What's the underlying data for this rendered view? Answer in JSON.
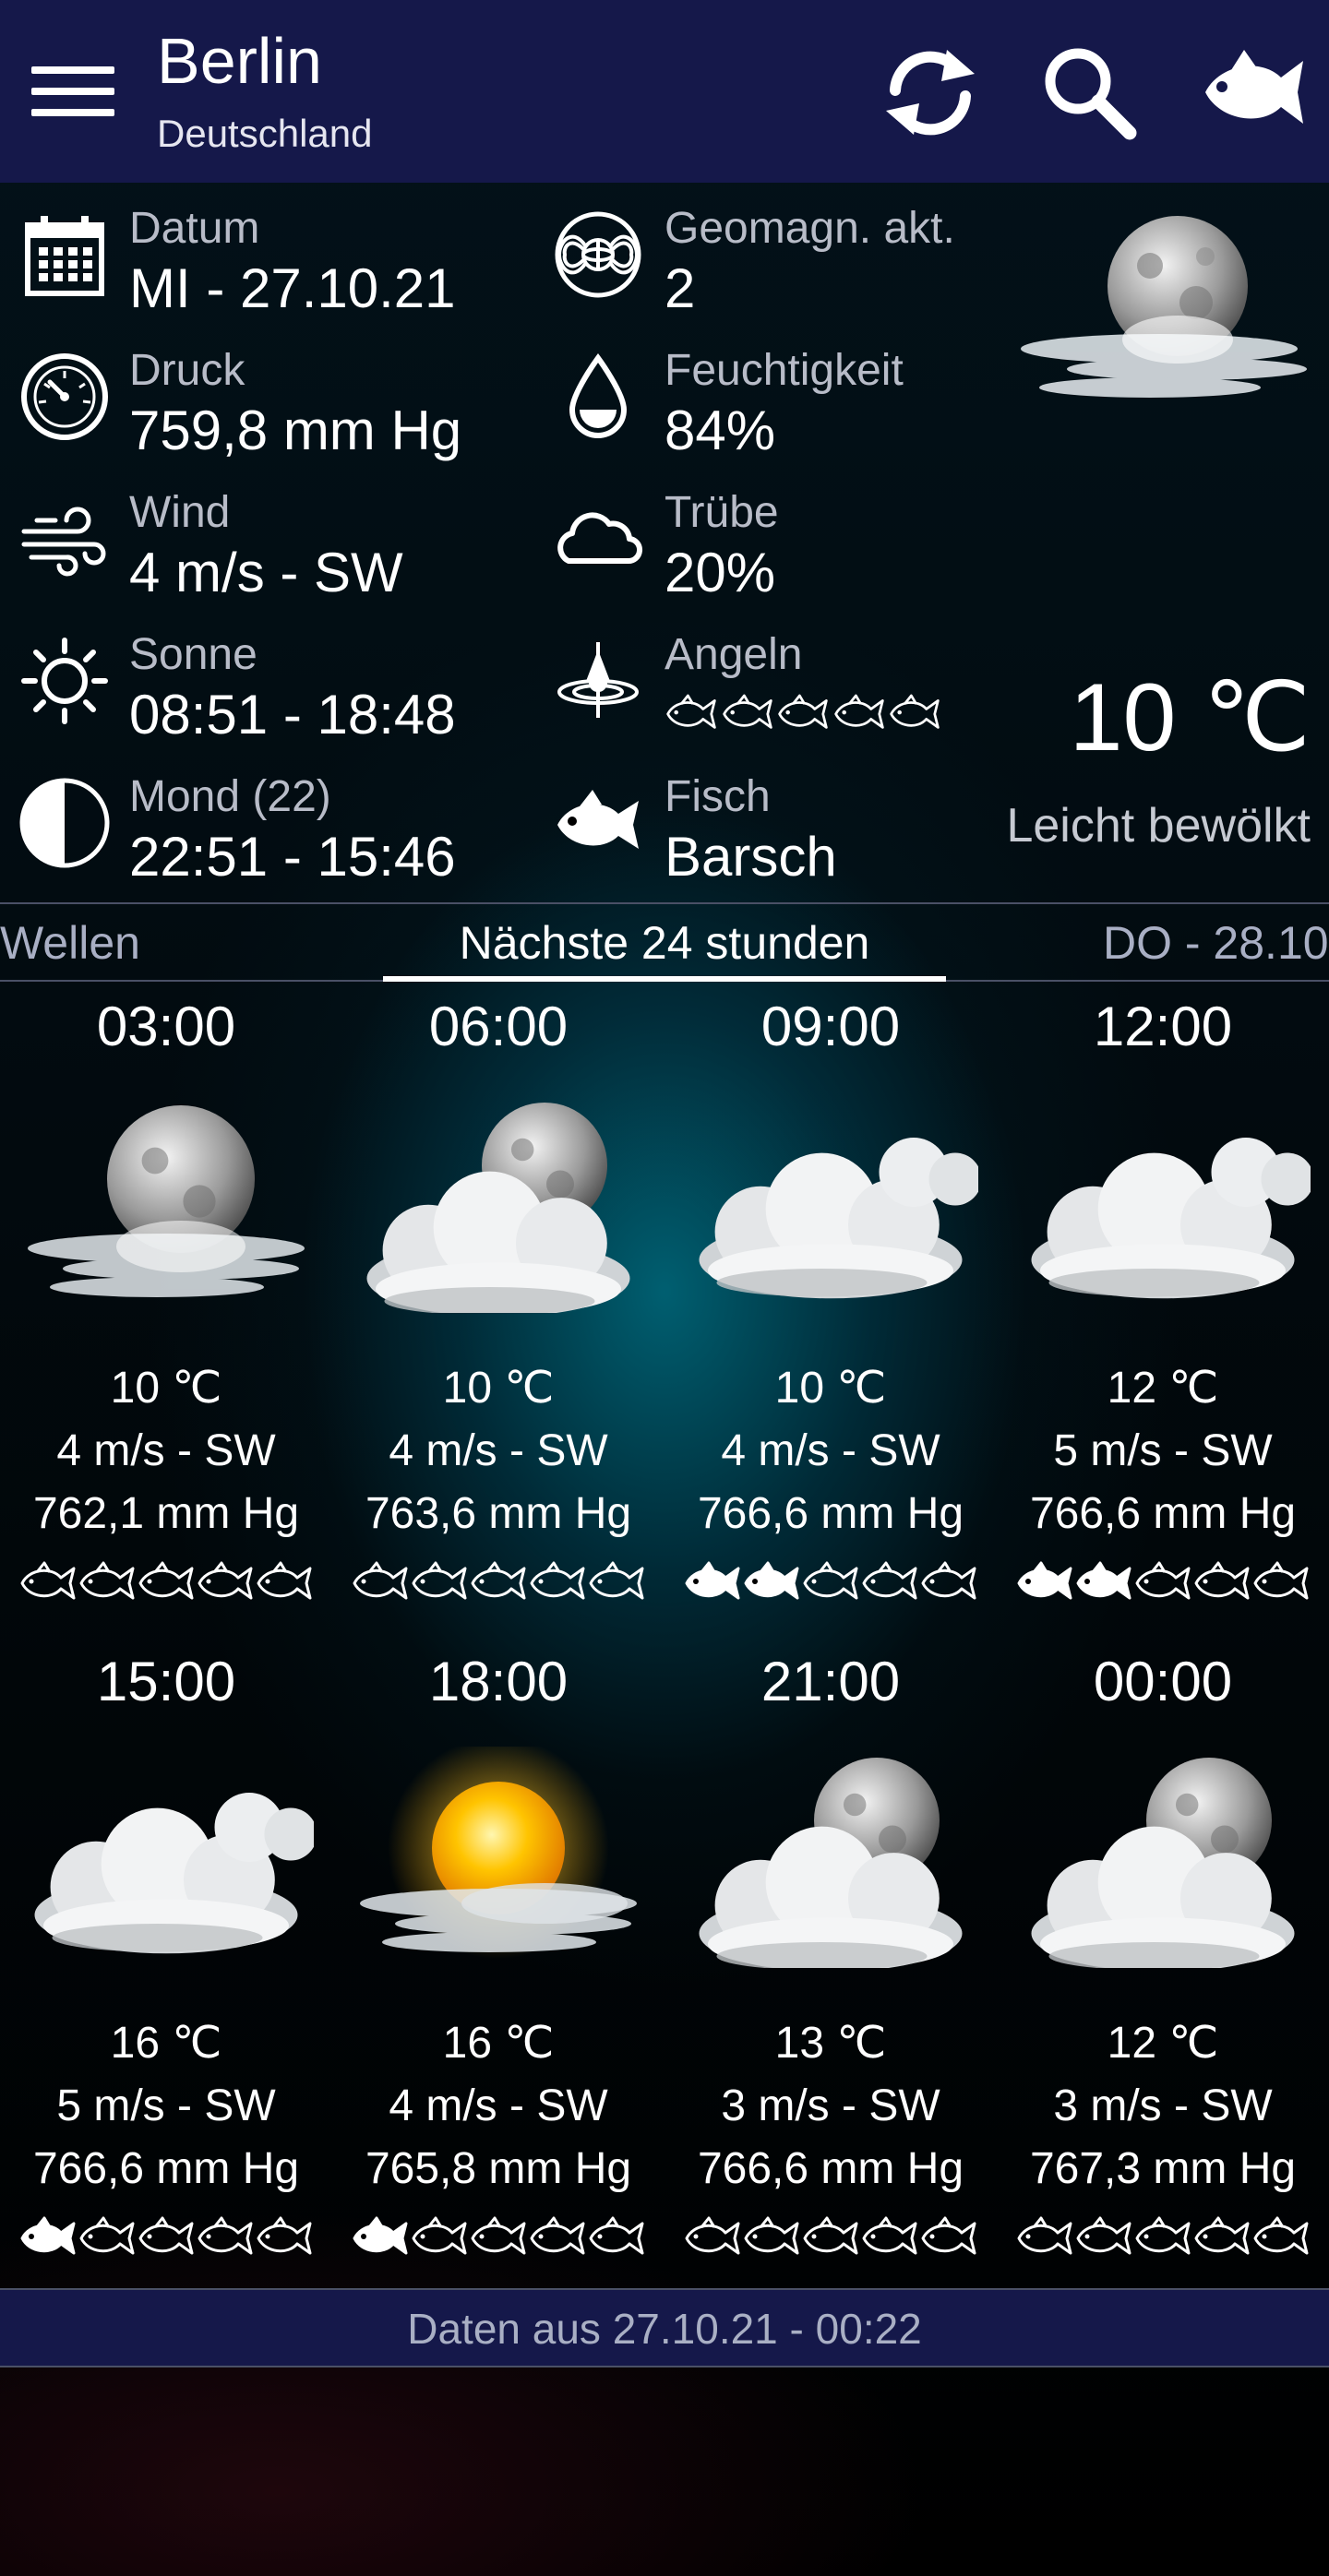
{
  "header": {
    "city": "Berlin",
    "country": "Deutschland",
    "icons": [
      "menu-icon",
      "refresh-icon",
      "search-icon",
      "fish-icon"
    ]
  },
  "current": {
    "date_label": "Datum",
    "date_value": "MI - 27.10.21",
    "geomag_label": "Geomagn. akt.",
    "geomag_value": "2",
    "pressure_label": "Druck",
    "pressure_value": "759,8 mm Hg",
    "humidity_label": "Feuchtigkeit",
    "humidity_value": "84%",
    "wind_label": "Wind",
    "wind_value": "4 m/s - SW",
    "cloud_label": "Trübe",
    "cloud_value": "20%",
    "sun_label": "Sonne",
    "sun_value": "08:51 - 18:48",
    "fishing_label": "Angeln",
    "fishing_rating": 0,
    "moon_label": "Mond (22)",
    "moon_value": "22:51 - 15:46",
    "fish_label": "Fisch",
    "fish_value": "Barsch",
    "temperature": "10 ℃",
    "condition": "Leicht bewölkt",
    "condition_icon": "moon-cloud-fog-icon"
  },
  "tabs": {
    "left": "Wellen",
    "center": "Nächste 24 stunden",
    "right": "DO - 28.10"
  },
  "forecast": [
    {
      "time": "03:00",
      "temp": "10 ℃",
      "wind": "4 m/s - SW",
      "pressure": "762,1 mm Hg",
      "fishing": 0,
      "icon": "moon-fog-icon"
    },
    {
      "time": "06:00",
      "temp": "10 ℃",
      "wind": "4 m/s - SW",
      "pressure": "763,6 mm Hg",
      "fishing": 0,
      "icon": "moon-cloud-icon"
    },
    {
      "time": "09:00",
      "temp": "10 ℃",
      "wind": "4 m/s - SW",
      "pressure": "766,6 mm Hg",
      "fishing": 2,
      "icon": "cloud-icon"
    },
    {
      "time": "12:00",
      "temp": "12 ℃",
      "wind": "5 m/s - SW",
      "pressure": "766,6 mm Hg",
      "fishing": 2,
      "icon": "cloud-icon"
    },
    {
      "time": "15:00",
      "temp": "16 ℃",
      "wind": "5 m/s - SW",
      "pressure": "766,6 mm Hg",
      "fishing": 1,
      "icon": "cloud-icon"
    },
    {
      "time": "18:00",
      "temp": "16 ℃",
      "wind": "4 m/s - SW",
      "pressure": "765,8 mm Hg",
      "fishing": 1,
      "icon": "sun-fog-icon"
    },
    {
      "time": "21:00",
      "temp": "13 ℃",
      "wind": "3 m/s - SW",
      "pressure": "766,6 mm Hg",
      "fishing": 0,
      "icon": "moon-cloud-icon"
    },
    {
      "time": "00:00",
      "temp": "12 ℃",
      "wind": "3 m/s - SW",
      "pressure": "767,3 mm Hg",
      "fishing": 0,
      "icon": "moon-cloud-icon"
    }
  ],
  "footer": {
    "text": "Daten aus 27.10.21 - 00:22"
  },
  "colors": {
    "header_bg": "#15184a",
    "label": "#b8bcc8",
    "accent_teal": "#006e82"
  }
}
